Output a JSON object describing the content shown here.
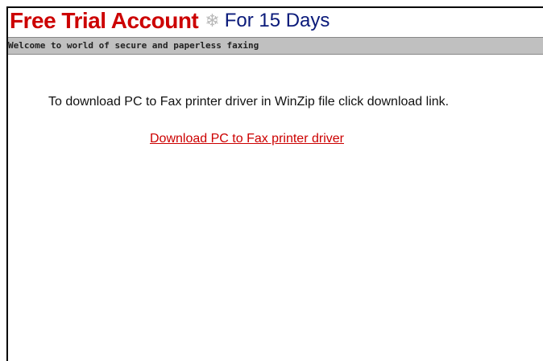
{
  "header": {
    "title": "Free Trial Account",
    "separator_icon": "snowflake-icon",
    "subtitle": "For 15 Days"
  },
  "tagline": "Welcome to world of secure and paperless faxing",
  "main": {
    "instruction": "To download PC to Fax printer driver in WinZip file click download link.",
    "download_link": "Download PC to Fax printer driver"
  },
  "colors": {
    "title_red": "#cc0000",
    "subtitle_blue": "#0a1a7a",
    "tagline_bar": "#c0c0c0",
    "link_red": "#cc0000"
  }
}
